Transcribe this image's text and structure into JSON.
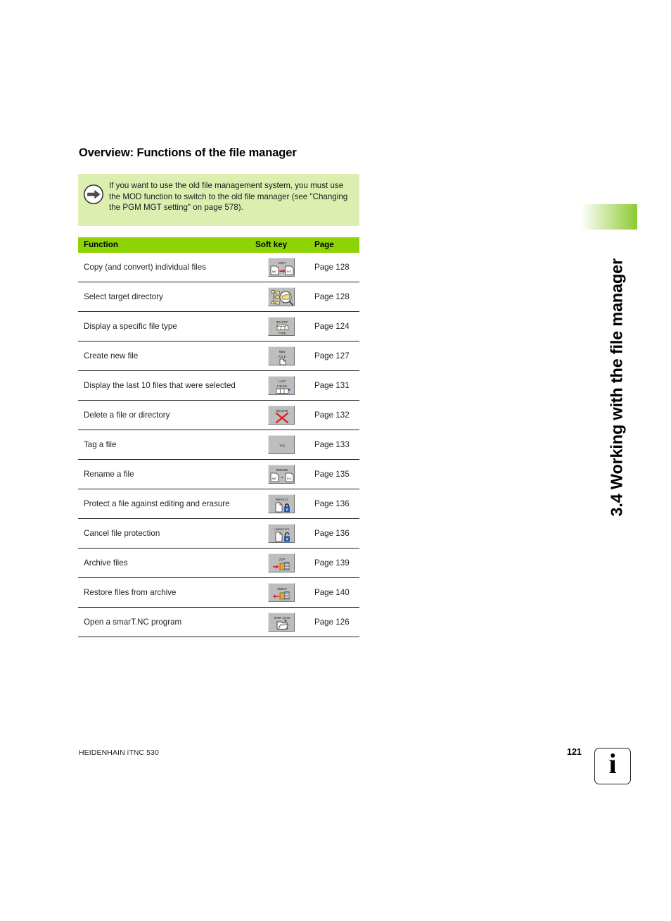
{
  "running_head": {
    "text": "3.4 Working with the file manager",
    "accent_color": "#8cca30"
  },
  "page_title": "Overview: Functions of the file manager",
  "note": {
    "icon": "arrow-right-circle-icon",
    "background_color": "#dcefb0",
    "text": "If you want to use the old file management system, you must use the MOD function to switch to the old file manager (see \"Changing the PGM MGT setting\" on page 578)."
  },
  "table": {
    "header_color": "#8ed405",
    "columns": [
      "Function",
      "Soft key",
      "Page"
    ],
    "rows": [
      {
        "function": "Copy (and convert) individual files",
        "softkey_name": "copy-softkey",
        "softkey_label": "COPY",
        "softkey_sub": "ABC → XYZ",
        "page": "Page 128"
      },
      {
        "function": "Select target directory",
        "softkey_name": "select-target-directory-softkey",
        "softkey_label": "",
        "softkey_sub": "",
        "page": "Page 128"
      },
      {
        "function": "Display a specific file type",
        "softkey_name": "select-type-softkey",
        "softkey_label": "SELECT",
        "softkey_sub": "TYPE",
        "page": "Page 124"
      },
      {
        "function": "Create new file",
        "softkey_name": "new-file-softkey",
        "softkey_label": "NEW",
        "softkey_sub": "FILE",
        "page": "Page 127"
      },
      {
        "function": "Display the last 10 files that were selected",
        "softkey_name": "last-files-softkey",
        "softkey_label": "LAST",
        "softkey_sub": "FILES",
        "page": "Page 131"
      },
      {
        "function": "Delete a file or directory",
        "softkey_name": "delete-softkey",
        "softkey_label": "DELETE",
        "softkey_sub": "",
        "page": "Page 132"
      },
      {
        "function": "Tag a file",
        "softkey_name": "tag-softkey",
        "softkey_label": "TAG",
        "softkey_sub": "",
        "page": "Page 133"
      },
      {
        "function": "Rename a file",
        "softkey_name": "rename-softkey",
        "softkey_label": "RENAME",
        "softkey_sub": "ABC = XYZ",
        "page": "Page 135"
      },
      {
        "function": "Protect a file against editing and erasure",
        "softkey_name": "protect-softkey",
        "softkey_label": "PROTECT",
        "softkey_sub": "",
        "page": "Page 136"
      },
      {
        "function": "Cancel file protection",
        "softkey_name": "unprotect-softkey",
        "softkey_label": "UNPROTECT",
        "softkey_sub": "",
        "page": "Page 136"
      },
      {
        "function": "Archive files",
        "softkey_name": "zip-softkey",
        "softkey_label": "ZIP",
        "softkey_sub": "",
        "page": "Page 139"
      },
      {
        "function": "Restore files from archive",
        "softkey_name": "unzip-softkey",
        "softkey_label": "UNZIP",
        "softkey_sub": "",
        "page": "Page 140"
      },
      {
        "function": "Open a smarT.NC program",
        "softkey_name": "open-with-softkey",
        "softkey_label": "OPEN WITH",
        "softkey_sub": "",
        "page": "Page 126"
      }
    ]
  },
  "footer": {
    "left": "HEIDENHAIN iTNC 530",
    "page_number": "121",
    "logo_glyph": "i"
  }
}
